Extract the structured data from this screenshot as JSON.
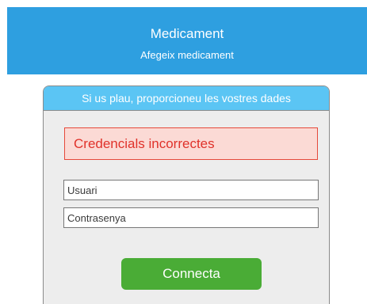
{
  "header": {
    "title": "Medicament",
    "subtitle": "Afegeix medicament"
  },
  "login_panel": {
    "heading": "Si us plau, proporcioneu les vostres dades",
    "error_message": "Credencials incorrectes",
    "username": {
      "placeholder": "Usuari",
      "value": ""
    },
    "password": {
      "placeholder": "Contrasenya",
      "value": ""
    },
    "connect_label": "Connecta"
  },
  "colors": {
    "header_bg": "#2e9fe0",
    "panel_header_bg": "#5bc5f4",
    "panel_bg": "#ededed",
    "error_bg": "#fbdad5",
    "error_border": "#e6493a",
    "error_text": "#e0322a",
    "button_bg": "#4aac36"
  }
}
